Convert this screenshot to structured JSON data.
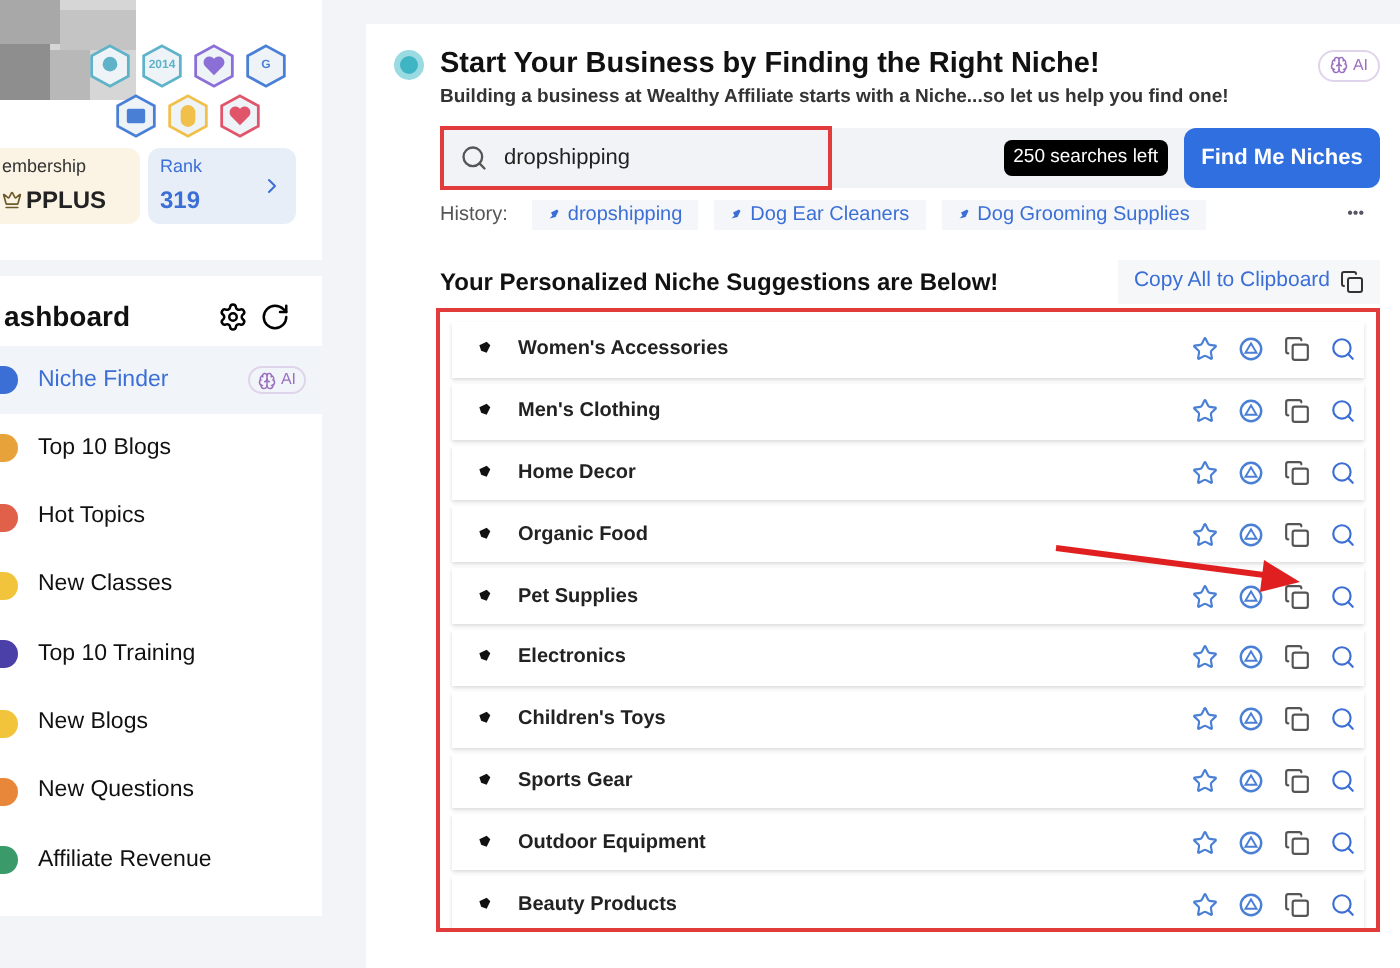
{
  "profile": {
    "badges": [
      {
        "kind": "figure",
        "color": "#5eb3c9"
      },
      {
        "kind": "year",
        "label": "2014",
        "color": "#5eb3c9"
      },
      {
        "kind": "heart",
        "color": "#8b6fd6"
      },
      {
        "kind": "letter",
        "label": "G",
        "color": "#4a7fd6"
      },
      {
        "kind": "screen",
        "color": "#4a7fd6"
      },
      {
        "kind": "medal",
        "color": "#f0c04a"
      },
      {
        "kind": "heart",
        "color": "#e0556a"
      }
    ],
    "membership": {
      "label": "embership",
      "value": "PPLUS"
    },
    "rank": {
      "label": "Rank",
      "value": "319"
    }
  },
  "sidebar": {
    "title": "ashboard",
    "items": [
      {
        "label": "Niche Finder",
        "selected": true,
        "ai": "AI",
        "color": "#3b6fd6"
      },
      {
        "label": "Top 10 Blogs",
        "selected": false,
        "color": "#e8a23a"
      },
      {
        "label": "Hot Topics",
        "selected": false,
        "color": "#e0604a"
      },
      {
        "label": "New Classes",
        "selected": false,
        "color": "#f2c43c"
      },
      {
        "label": "Top 10 Training",
        "selected": false,
        "color": "#4b3fa8"
      },
      {
        "label": "New Blogs",
        "selected": false,
        "color": "#f2c43c"
      },
      {
        "label": "New Questions",
        "selected": false,
        "color": "#e8873a"
      },
      {
        "label": "Affiliate Revenue",
        "selected": false,
        "color": "#3a9a6a"
      }
    ]
  },
  "main": {
    "title": "Start Your Business by Finding the Right Niche!",
    "ai": "AI",
    "subtitle": "Building a business at Wealthy Affiliate starts with a Niche...so let us help you find one!",
    "search": {
      "value": "dropshipping",
      "highlighted": true
    },
    "searches_left": "250 searches left",
    "button": "Find Me Niches",
    "history_label": "History:",
    "history": [
      "dropshipping",
      "Dog Ear Cleaners",
      "Dog Grooming Supplies"
    ],
    "more": "•••",
    "suggestions_title": "Your Personalized Niche Suggestions are Below!",
    "copy_all": "Copy All to Clipboard",
    "list_highlighted": true,
    "niches": [
      {
        "name": "Women's Accessories",
        "pointed": false
      },
      {
        "name": "Men's Clothing",
        "pointed": false
      },
      {
        "name": "Home Decor",
        "pointed": false
      },
      {
        "name": "Organic Food",
        "pointed": false
      },
      {
        "name": "Pet Supplies",
        "pointed": true
      },
      {
        "name": "Electronics",
        "pointed": false
      },
      {
        "name": "Children's Toys",
        "pointed": false
      },
      {
        "name": "Sports Gear",
        "pointed": false
      },
      {
        "name": "Outdoor Equipment",
        "pointed": false
      },
      {
        "name": "Beauty Products",
        "pointed": false
      }
    ]
  }
}
